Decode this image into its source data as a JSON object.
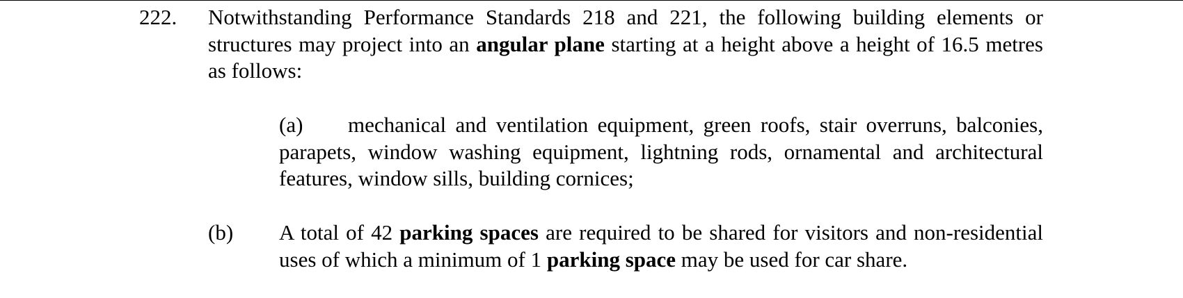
{
  "clause_222": {
    "number": "222.",
    "text_1": "Notwithstanding Performance Standards 218 and 221, the following building elements or structures may project into an ",
    "term_1": "angular plane",
    "text_2": " starting at a height above a height of 16.5 metres as follows:"
  },
  "item_a": {
    "marker": "(a)",
    "text": "mechanical and ventilation equipment, green roofs, stair overruns, balconies, parapets, window washing equipment, lightning rods, ornamental and architectural features, window sills, building cornices;"
  },
  "item_b": {
    "marker": "(b)",
    "text_1": "A total of 42 ",
    "term_1": "parking spaces",
    "text_2": " are required to be shared for visitors and non-residential uses of which a minimum of 1 ",
    "term_2": "parking space",
    "text_3": " may be used for car share."
  }
}
